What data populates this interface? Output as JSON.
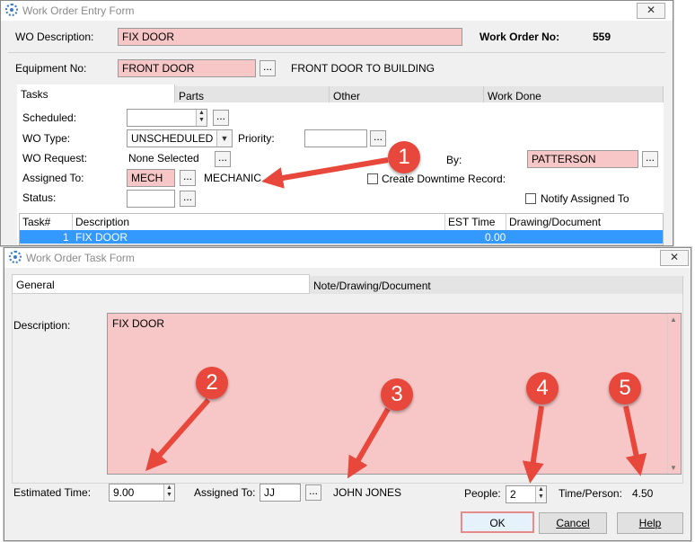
{
  "entry_form": {
    "title": "Work Order Entry Form",
    "close_label": "✕",
    "wo_description_label": "WO Description:",
    "wo_description_value": "FIX DOOR",
    "work_order_no_label": "Work Order  No:",
    "work_order_no_value": "559",
    "equipment_no_label": "Equipment No:",
    "equipment_no_value": "FRONT DOOR",
    "equipment_desc": "FRONT DOOR TO BUILDING",
    "tabs": [
      "Tasks",
      "Parts",
      "Other",
      "Work Done"
    ],
    "scheduled_label": "Scheduled:",
    "scheduled_value": "",
    "wo_type_label": "WO Type:",
    "wo_type_value": "UNSCHEDULED",
    "priority_label": "Priority:",
    "priority_value": "",
    "wo_request_label": "WO Request:",
    "wo_request_value": "None Selected",
    "by_label": "By:",
    "by_value": "PATTERSON",
    "assigned_to_label": "Assigned To:",
    "assigned_to_value": "MECH",
    "assigned_to_desc": "MECHANIC",
    "create_downtime_label": "Create Downtime Record:",
    "status_label": "Status:",
    "status_value": "",
    "notify_label": "Notify Assigned To",
    "table": {
      "columns": [
        "Task#",
        "Description",
        "EST Time",
        "Drawing/Document"
      ],
      "rows": [
        {
          "task": "1",
          "description": "FIX DOOR",
          "est_time": "0.00",
          "drawing": ""
        }
      ]
    },
    "dots": "..."
  },
  "task_form": {
    "title": "Work Order Task Form",
    "close_label": "✕",
    "tabs": [
      "General",
      "Note/Drawing/Document"
    ],
    "description_label": "Description:",
    "description_value": "FIX DOOR",
    "estimated_time_label": "Estimated Time:",
    "estimated_time_value": "9.00",
    "assigned_to_label": "Assigned To:",
    "assigned_to_value": "JJ",
    "assigned_to_name": "JOHN JONES",
    "people_label": "People:",
    "people_value": "2",
    "time_person_label": "Time/Person:",
    "time_person_value": "4.50",
    "ok_label": "OK",
    "cancel_label": "Cancel",
    "help_label": "Help"
  },
  "annotations": [
    "1",
    "2",
    "3",
    "4",
    "5"
  ],
  "colors": {
    "required_field": "#f7c6c6",
    "selected_row": "#3399ff",
    "marker": "#e8473b"
  }
}
